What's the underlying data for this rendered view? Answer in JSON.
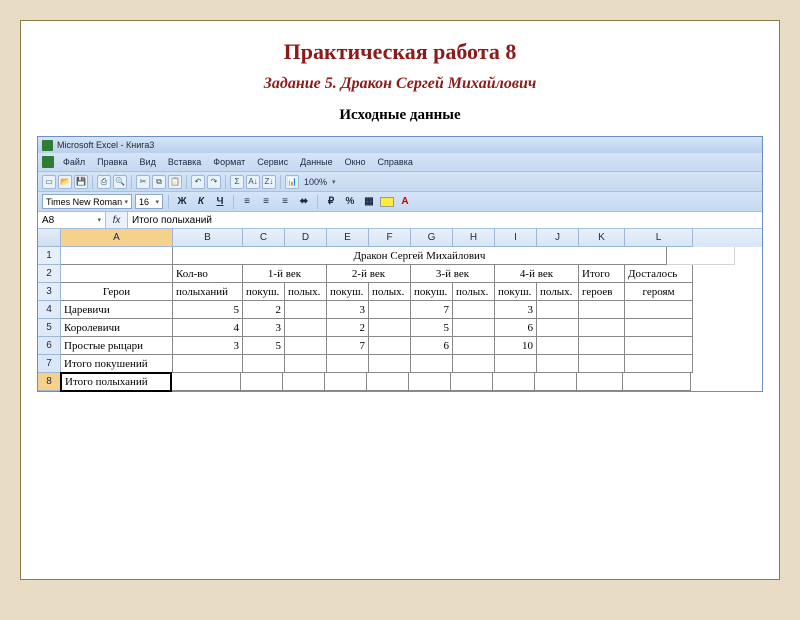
{
  "slide": {
    "title": "Практическая работа 8",
    "subtitle": "Задание 5. Дракон Сергей Михайлович",
    "heading": "Исходные данные"
  },
  "excel": {
    "window_title": "Microsoft Excel - Книга3",
    "menu": [
      "Файл",
      "Правка",
      "Вид",
      "Вставка",
      "Формат",
      "Сервис",
      "Данные",
      "Окно",
      "Справка"
    ],
    "zoom": "100%",
    "font_name": "Times New Roman",
    "font_size": "16",
    "name_box": "A8",
    "fx": "fx",
    "formula_value": "Итого полыханий",
    "columns": [
      "A",
      "B",
      "C",
      "D",
      "E",
      "F",
      "G",
      "H",
      "I",
      "J",
      "K",
      "L"
    ],
    "row_numbers": [
      "1",
      "2",
      "3",
      "4",
      "5",
      "6",
      "7",
      "8"
    ],
    "r1_merged": "Дракон Сергей Михайлович",
    "r2": {
      "B": "Кол-во",
      "CD": "1-й век",
      "EF": "2-й век",
      "GH": "3-й век",
      "IJ": "4-й век",
      "K": "Итого",
      "L": "Досталось"
    },
    "r3": {
      "A": "Герои",
      "B": "полыханий",
      "C": "покуш.",
      "D": "полых.",
      "E": "покуш.",
      "F": "полых.",
      "G": "покуш.",
      "H": "полых.",
      "I": "покуш.",
      "J": "полых.",
      "K": "героев",
      "L": "героям"
    },
    "rows": [
      {
        "A": "Царевичи",
        "B": "5",
        "C": "2",
        "D": "",
        "E": "3",
        "F": "",
        "G": "7",
        "H": "",
        "I": "3",
        "J": "",
        "K": "",
        "L": ""
      },
      {
        "A": "Королевичи",
        "B": "4",
        "C": "3",
        "D": "",
        "E": "2",
        "F": "",
        "G": "5",
        "H": "",
        "I": "6",
        "J": "",
        "K": "",
        "L": ""
      },
      {
        "A": "Простые рыцари",
        "B": "3",
        "C": "5",
        "D": "",
        "E": "7",
        "F": "",
        "G": "6",
        "H": "",
        "I": "10",
        "J": "",
        "K": "",
        "L": ""
      },
      {
        "A": "Итого покушений",
        "B": "",
        "C": "",
        "D": "",
        "E": "",
        "F": "",
        "G": "",
        "H": "",
        "I": "",
        "J": "",
        "K": "",
        "L": ""
      },
      {
        "A": "Итого полыханий",
        "B": "",
        "C": "",
        "D": "",
        "E": "",
        "F": "",
        "G": "",
        "H": "",
        "I": "",
        "J": "",
        "K": "",
        "L": ""
      }
    ]
  },
  "icons": {
    "bold": "Ж",
    "italic": "К",
    "underline": "Ч",
    "sigma": "Σ",
    "chevron": "▾"
  },
  "chart_data": {
    "type": "table",
    "title": "Дракон Сергей Михайлович",
    "columns": [
      "Герои",
      "Кол-во полыханий",
      "1-й век покуш.",
      "1-й век полых.",
      "2-й век покуш.",
      "2-й век полых.",
      "3-й век покуш.",
      "3-й век полых.",
      "4-й век покуш.",
      "4-й век полых.",
      "Итого героев",
      "Досталось героям"
    ],
    "rows": [
      [
        "Царевичи",
        5,
        2,
        null,
        3,
        null,
        7,
        null,
        3,
        null,
        null,
        null
      ],
      [
        "Королевичи",
        4,
        3,
        null,
        2,
        null,
        5,
        null,
        6,
        null,
        null,
        null
      ],
      [
        "Простые рыцари",
        3,
        5,
        null,
        7,
        null,
        6,
        null,
        10,
        null,
        null,
        null
      ],
      [
        "Итого покушений",
        null,
        null,
        null,
        null,
        null,
        null,
        null,
        null,
        null,
        null,
        null
      ],
      [
        "Итого полыханий",
        null,
        null,
        null,
        null,
        null,
        null,
        null,
        null,
        null,
        null,
        null
      ]
    ]
  }
}
